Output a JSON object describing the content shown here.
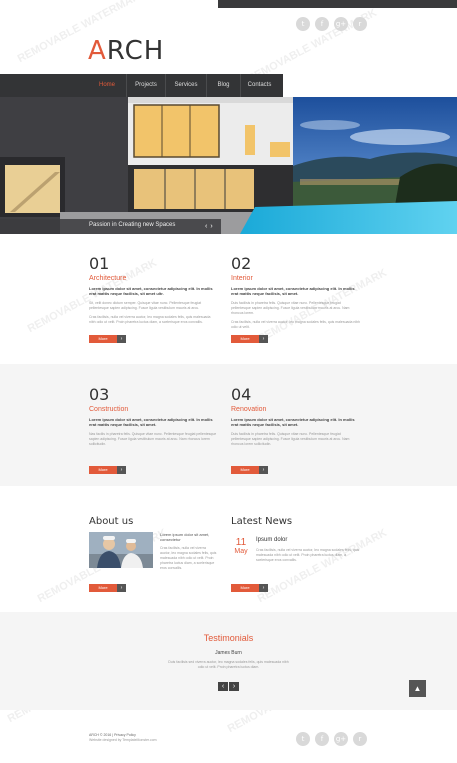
{
  "logo": {
    "first": "A",
    "rest": "RCH"
  },
  "social": {
    "items": [
      {
        "icon": "twitter-icon",
        "glyph": "t"
      },
      {
        "icon": "facebook-icon",
        "glyph": "f"
      },
      {
        "icon": "google-plus-icon",
        "glyph": "g+"
      },
      {
        "icon": "rss-icon",
        "glyph": "r"
      }
    ]
  },
  "nav": {
    "items": [
      "Home",
      "Projects",
      "Services",
      "Blog",
      "Contacts"
    ],
    "active": "Home"
  },
  "hero": {
    "caption": "Passion in Creating new Spaces",
    "prev": "‹",
    "next": "›"
  },
  "features": [
    {
      "num": "01",
      "title": "Architecture",
      "lead": "Lorem ipsum dolor sit amet, consectetur adipiscing elit. In mollis erat mattis neque facilisis, sit amet ultr.",
      "body1": "Sit, velit donec dictum semper. Quisque vitae nunc. Pellentesque feugiat pellentesque sapien adipiscing. Fusce ligula vestibulum mauris at arcu.",
      "body2": "Cras facilisis, nulla vel viverra auctor, leo magna sodales felis, quis malesuada nibh odio ut velit. Proin pharetra luctus diam, a scelerisque eros convallis.",
      "more": "More"
    },
    {
      "num": "02",
      "title": "Interior",
      "lead": "Lorem ipsum dolor sit amet, consectetur adipiscing elit. In mollis erat mattis neque facilisis, sit amet.",
      "body1": "Duis facilisis in pharetra felis. Quisque vitae nunc. Pellentesque feugiat pellentesque sapien adipiscing. Fusce ligula vestibulum mauris at arcu. Nam rhoncus lorem.",
      "body2": "Cras facilisis, nulla vel viverra auctor, leo magna sodales felis, quis malesuada nibh odio ut velit.",
      "more": "More"
    },
    {
      "num": "03",
      "title": "Construction",
      "lead": "Lorem ipsum dolor sit amet, consectetur adipiscing elit. In mollis erat mattis neque facilisis, sit amet.",
      "body1": "Nas facilis in pharetra felis. Quisque vitae nunc. Pellentesque feugiat pellentesque sapien adipiscing. Fusce ligula vestibulum mauris at arcu. Nam rhoncus lorem sollicitudin.",
      "body2": "",
      "more": "More"
    },
    {
      "num": "04",
      "title": "Renovation",
      "lead": "Lorem ipsum dolor sit amet, consectetur adipiscing elit. In mollis erat mattis neque facilisis, sit amet.",
      "body1": "Duis facilisis in pharetra felis. Quisque vitae nunc. Pellentesque feugiat pellentesque sapien adipiscing. Fusce ligula vestibulum mauris at arcu. Nam rhoncus lorem sollicitudin.",
      "body2": "",
      "more": "More"
    }
  ],
  "about": {
    "title": "About us",
    "lead": "Lorem ipsum dolor sit amet, consectetur",
    "body": "Cras facilisis, nulla vel viverra auctor, leo magna sodales felis, quis malesuada nibh odio ut velit. Proin pharetra luctus diam, a scelerisque eros convallis.",
    "more": "More"
  },
  "news": {
    "title": "Latest News",
    "day": "11",
    "month": "May",
    "headline": "Ipsum dolor",
    "body": "Cras facilisis, nulla vel viverra auctor, leo magna sodales felis, quis malesuada nibh odio ut velit. Proin pharetra luctus diam, a scelerisque eros convallis.",
    "more": "More"
  },
  "testimonials": {
    "title": "Testimonials",
    "name": "James Burn",
    "quote": "Duis facilisis sed viverra auctor, leo magna sodales felis, quis malesuada nibh odio ut velit. Proin pharetra luctus diam.",
    "prev": "‹",
    "next": "›"
  },
  "footer": {
    "line1": "ARCH © 2016 | Privacy Policy",
    "line2": "Website designed by TemplateMonster.com"
  },
  "watermark": "REMOVABLE WATERMARK",
  "colors": {
    "accent": "#e25a3a",
    "nav_bg": "#333436",
    "dark_button": "#555555"
  }
}
